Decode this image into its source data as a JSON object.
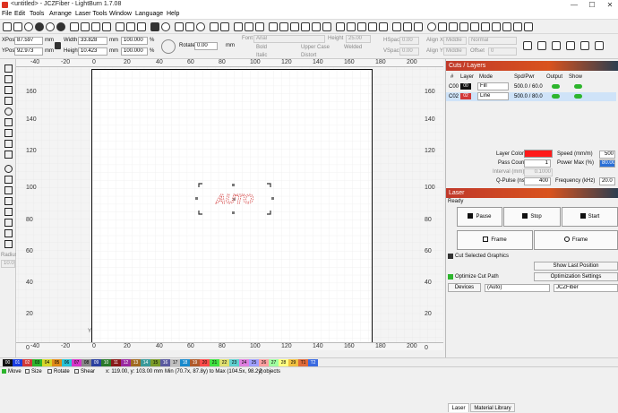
{
  "window": {
    "title": "<untitled> - JCZFiber - LightBurn 1.7.08",
    "minimize": "—",
    "maximize": "☐",
    "close": "✕"
  },
  "menu": [
    "File",
    "Edit",
    "Tools",
    "Arrange",
    "Laser Tools",
    "Window",
    "Language",
    "Help"
  ],
  "numeric_edits": {
    "xpos_label": "XPos",
    "xpos": "87.597",
    "ypos_label": "YPos",
    "ypos": "92.973",
    "width_label": "Width",
    "width": "33.828",
    "height_label": "Height",
    "height": "10.423",
    "unit": "mm",
    "scale_w": "100.000",
    "scale_h": "100.000",
    "pct": "%",
    "rotate_label": "Rotate",
    "rotate": "0.00",
    "rotate_unit": "mm"
  },
  "text_tools": {
    "font_label": "Font",
    "font_value": "Arial",
    "height_label": "Height",
    "height_value": "25.00",
    "hspace_label": "HSpace",
    "hspace_value": "0.00",
    "vspace_label": "VSpace",
    "vspace_value": "0.00",
    "alignx_label": "Align X",
    "alignx_value": "Middle",
    "aligny_label": "Align Y",
    "aligny_value": "Middle",
    "normal_value": "Normal",
    "offset_label": "Offset",
    "offset_value": "0",
    "bold": "Bold",
    "italic": "Italic",
    "upper": "Upper Case",
    "welded": "Welded",
    "distort": "Distort"
  },
  "rulers": {
    "top": [
      "-40",
      "-20",
      "0",
      "20",
      "40",
      "60",
      "80",
      "100",
      "120",
      "140",
      "160",
      "180",
      "200"
    ],
    "left": [
      "160",
      "140",
      "120",
      "100",
      "80",
      "60",
      "40",
      "20",
      "0"
    ]
  },
  "canvas": {
    "text_object": "AUTO",
    "corner_y": "Y"
  },
  "cuts_panel": {
    "title": "Cuts / Layers",
    "headers": [
      "#",
      "Layer",
      "Mode",
      "Spd/Pwr",
      "Output",
      "Show"
    ],
    "rows": [
      {
        "num": "C00",
        "badge": "00",
        "color": "#111111",
        "mode": "Fill",
        "spdpwr": "500.0 / 60.0"
      },
      {
        "num": "C02",
        "badge": "02",
        "color": "#d23838",
        "mode": "Line",
        "spdpwr": "500.0 / 80.0"
      }
    ],
    "layer_color_label": "Layer Color",
    "layer_color": "#ff1a1a",
    "speed_label": "Speed (mm/m)",
    "speed": "500",
    "pass_label": "Pass Count",
    "pass": "1",
    "powermax_label": "Power Max (%)",
    "powermax": "80.00",
    "interval_label": "Interval (mm)",
    "interval": "0.1000",
    "qpulse_label": "Q-Pulse (ns)",
    "qpulse": "400",
    "freq_label": "Frequency (kHz)",
    "freq": "20.0"
  },
  "laser_panel": {
    "title": "Laser",
    "status": "Ready",
    "pause": "Pause",
    "stop": "Stop",
    "start": "Start",
    "frame1": "Frame",
    "frame2": "Frame",
    "cut_selected": "Cut Selected Graphics",
    "show_last": "Show Last Position",
    "optimize_cut": "Optimize Cut Path",
    "opt_settings": "Optimization Settings",
    "devices": "Devices",
    "auto": "(Auto)",
    "device_name": "JCZFiber"
  },
  "tabs": [
    "Laser",
    "Material Library"
  ],
  "left_tools": {
    "radius_label": "Radius:",
    "radius_value": "10.0"
  },
  "palette": [
    {
      "n": "00",
      "c": "#111111",
      "t": "#ffffff"
    },
    {
      "n": "01",
      "c": "#1a3de0",
      "t": "#ffffff"
    },
    {
      "n": "02",
      "c": "#d23838",
      "t": "#ffffff"
    },
    {
      "n": "03",
      "c": "#2db52d",
      "t": "#000000"
    },
    {
      "n": "04",
      "c": "#d6d62a",
      "t": "#000000"
    },
    {
      "n": "05",
      "c": "#e08a1a",
      "t": "#000000"
    },
    {
      "n": "06",
      "c": "#29c3d6",
      "t": "#000000"
    },
    {
      "n": "07",
      "c": "#d636c8",
      "t": "#000000"
    },
    {
      "n": "08",
      "c": "#888888",
      "t": "#000000"
    },
    {
      "n": "09",
      "c": "#2a3fa0",
      "t": "#ffffff"
    },
    {
      "n": "10",
      "c": "#2a7a2a",
      "t": "#ffffff"
    },
    {
      "n": "11",
      "c": "#8a1a1a",
      "t": "#ffffff"
    },
    {
      "n": "12",
      "c": "#9a2aa0",
      "t": "#ffffff"
    },
    {
      "n": "13",
      "c": "#a06a20",
      "t": "#ffffff"
    },
    {
      "n": "14",
      "c": "#3a9a9a",
      "t": "#ffffff"
    },
    {
      "n": "15",
      "c": "#7a9a2a",
      "t": "#000000"
    },
    {
      "n": "16",
      "c": "#5a5aa0",
      "t": "#ffffff"
    },
    {
      "n": "17",
      "c": "#c0c0c0",
      "t": "#000000"
    },
    {
      "n": "18",
      "c": "#1a8acc",
      "t": "#ffffff"
    },
    {
      "n": "19",
      "c": "#b05a2a",
      "t": "#ffffff"
    },
    {
      "n": "20",
      "c": "#ff4a4a",
      "t": "#000000"
    },
    {
      "n": "21",
      "c": "#40e040",
      "t": "#000000"
    },
    {
      "n": "22",
      "c": "#e0e070",
      "t": "#000000"
    },
    {
      "n": "23",
      "c": "#60d0d0",
      "t": "#000000"
    },
    {
      "n": "24",
      "c": "#e080e0",
      "t": "#000000"
    },
    {
      "n": "25",
      "c": "#a0a0ff",
      "t": "#000000"
    },
    {
      "n": "26",
      "c": "#ffa0a0",
      "t": "#000000"
    },
    {
      "n": "27",
      "c": "#a0ffa0",
      "t": "#000000"
    },
    {
      "n": "28",
      "c": "#ffff80",
      "t": "#000000"
    },
    {
      "n": "29",
      "c": "#f0c040",
      "t": "#000000"
    },
    {
      "n": "T1",
      "c": "#e06a3a",
      "t": "#000000"
    },
    {
      "n": "T2",
      "c": "#3a6ae0",
      "t": "#ffffff"
    }
  ],
  "status": {
    "move": "Move",
    "size": "Size",
    "rotate": "Rotate",
    "shear": "Shear",
    "coords": "x: 119.00, y: 103.00 mm",
    "range": "Min (70.7x, 87.8y) to Max (104.5x, 98.2y)",
    "objects": "2 objects"
  }
}
